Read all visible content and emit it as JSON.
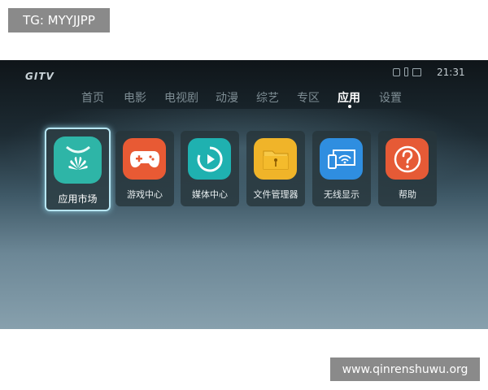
{
  "overlay": {
    "top_tag": "TG: MYYJJPP",
    "bottom_watermark": "www.qinrenshuwu.org"
  },
  "tv": {
    "brand": "GITV",
    "clock": "21:31",
    "status_icons": [
      "network-icon",
      "usb-icon",
      "screen-cast-icon"
    ],
    "nav": {
      "active_index": 6,
      "items": [
        "首页",
        "电影",
        "电视剧",
        "动漫",
        "综艺",
        "专区",
        "应用",
        "设置"
      ]
    },
    "apps": {
      "focused_index": 0,
      "items": [
        {
          "label": "应用市场",
          "icon": "huawei-bag-icon",
          "color": "#2eb5a7"
        },
        {
          "label": "游戏中心",
          "icon": "gamepad-icon",
          "color": "#e85a34"
        },
        {
          "label": "媒体中心",
          "icon": "play-circle-icon",
          "color": "#1fb1b0"
        },
        {
          "label": "文件管理器",
          "icon": "folder-icon",
          "color": "#f0b429"
        },
        {
          "label": "无线显示",
          "icon": "cast-screen-icon",
          "color": "#2f8ee0"
        },
        {
          "label": "帮助",
          "icon": "help-icon",
          "color": "#e65a36"
        }
      ]
    }
  }
}
